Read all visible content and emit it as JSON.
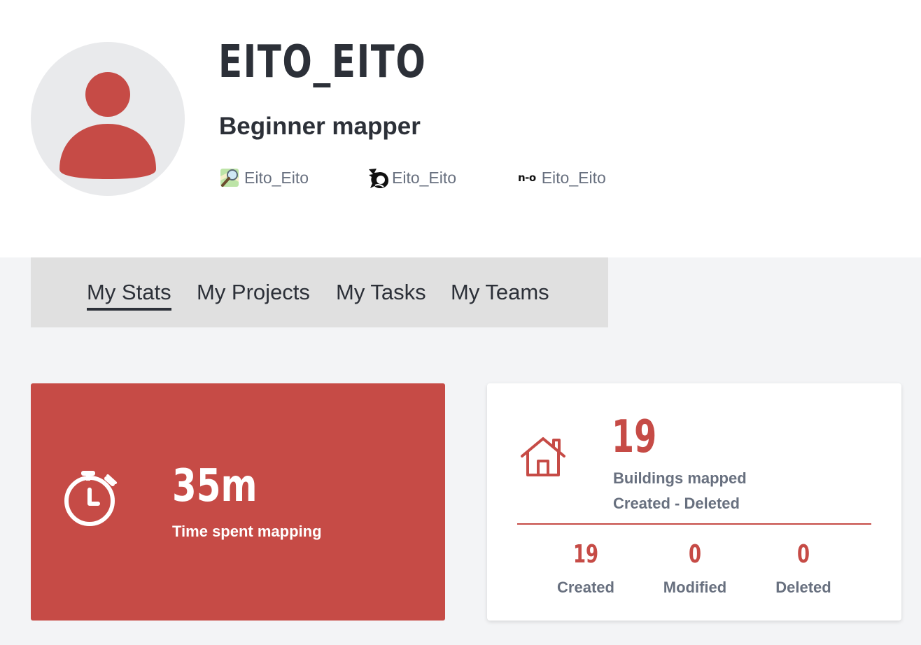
{
  "profile": {
    "username": "EITO_EITO",
    "level": "Beginner mapper",
    "accounts": [
      {
        "icon": "openstreetmap-icon",
        "name": "Eito_Eito"
      },
      {
        "icon": "osmcha-icon",
        "name": "Eito_Eito"
      },
      {
        "icon": "hdyc-icon",
        "name": "Eito_Eito",
        "badge": "n-o"
      }
    ]
  },
  "tabs": [
    {
      "label": "My Stats",
      "active": true
    },
    {
      "label": "My Projects",
      "active": false
    },
    {
      "label": "My Tasks",
      "active": false
    },
    {
      "label": "My Teams",
      "active": false
    }
  ],
  "stats": {
    "time": {
      "icon": "stopwatch-icon",
      "value": "35m",
      "label": "Time spent mapping"
    },
    "buildings": {
      "icon": "house-icon",
      "value": "19",
      "label": "Buildings mapped",
      "sublabel": "Created - Deleted",
      "breakdown": [
        {
          "value": "19",
          "label": "Created"
        },
        {
          "value": "0",
          "label": "Modified"
        },
        {
          "value": "0",
          "label": "Deleted"
        }
      ]
    }
  },
  "colors": {
    "accent": "#c64b46",
    "text_dark": "#2c3038",
    "text_muted": "#68707f",
    "background": "#f3f4f6",
    "tab_bar": "#e0e0e0",
    "avatar_bg": "#e9eaec"
  }
}
